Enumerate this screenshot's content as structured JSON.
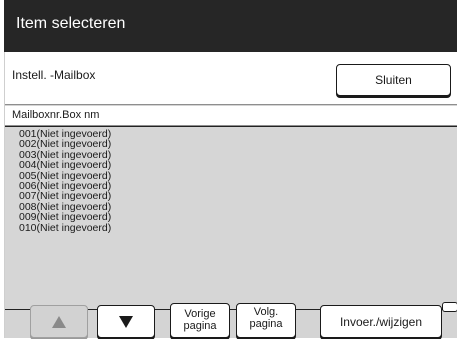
{
  "window": {
    "title": "Item selecteren"
  },
  "subheader": {
    "title": "Instell. -Mailbox",
    "close_label": "Sluiten"
  },
  "list": {
    "header": "Mailboxnr.Box nm",
    "items": [
      "001(Niet ingevoerd)",
      "002(Niet ingevoerd)",
      "003(Niet ingevoerd)",
      "004(Niet ingevoerd)",
      "005(Niet ingevoerd)",
      "006(Niet ingevoerd)",
      "007(Niet ingevoerd)",
      "008(Niet ingevoerd)",
      "009(Niet ingevoerd)",
      "010(Niet ingevoerd)"
    ]
  },
  "footer": {
    "prev_label_1": "Vorige",
    "prev_label_2": "pagina",
    "next_label_1": "Volg.",
    "next_label_2": "pagina",
    "edit_label": "Invoer./wijzigen",
    "up_icon": "triangle-up-icon",
    "down_icon": "triangle-down-icon"
  }
}
